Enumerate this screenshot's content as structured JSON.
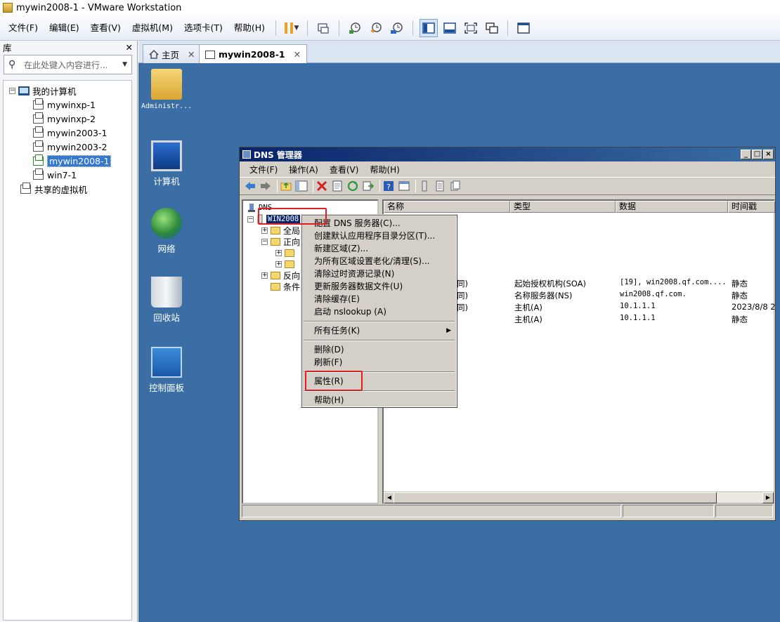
{
  "window": {
    "title": "mywin2008-1 - VMware Workstation"
  },
  "menu": [
    {
      "label": "文件(F)",
      "name": "menu-file"
    },
    {
      "label": "编辑(E)",
      "name": "menu-edit"
    },
    {
      "label": "查看(V)",
      "name": "menu-view"
    },
    {
      "label": "虚拟机(M)",
      "name": "menu-vm"
    },
    {
      "label": "选项卡(T)",
      "name": "menu-tabs"
    },
    {
      "label": "帮助(H)",
      "name": "menu-help"
    }
  ],
  "library": {
    "title": "库",
    "close": "✕",
    "search_placeholder": "在此处键入内容进行...",
    "root": "我的计算机",
    "vms": [
      "mywinxp-1",
      "mywinxp-2",
      "mywin2003-1",
      "mywin2003-2",
      "mywin2008-1",
      "win7-1"
    ],
    "selected": "mywin2008-1",
    "shared": "共享的虚拟机"
  },
  "tabs": [
    {
      "label": "主页",
      "close": "✕"
    },
    {
      "label": "mywin2008-1",
      "close": "✕"
    }
  ],
  "desktop": {
    "icons": [
      "Administr...",
      "计算机",
      "网络",
      "回收站",
      "控制面板"
    ]
  },
  "dns": {
    "title": "DNS 管理器",
    "menu": [
      "文件(F)",
      "操作(A)",
      "查看(V)",
      "帮助(H)"
    ],
    "tree": {
      "root": "DNS",
      "server": "WIN2008",
      "children": [
        "全局",
        "正向",
        "反向",
        "条件"
      ]
    },
    "columns": [
      "名称",
      "类型",
      "数据",
      "时间戳"
    ],
    "records": [
      {
        "name": "同)",
        "type": "起始授权机构(SOA)",
        "data": "[19], win2008.qf.com....",
        "stamp": "静态"
      },
      {
        "name": "同)",
        "type": "名称服务器(NS)",
        "data": "win2008.qf.com.",
        "stamp": "静态"
      },
      {
        "name": "同)",
        "type": "主机(A)",
        "data": "10.1.1.1",
        "stamp": "2023/8/8 2"
      },
      {
        "name": "",
        "type": "主机(A)",
        "data": "10.1.1.1",
        "stamp": "静态"
      }
    ]
  },
  "context_menu": {
    "items": [
      "配置 DNS 服务器(C)...",
      "创建默认应用程序目录分区(T)...",
      "新建区域(Z)...",
      "为所有区域设置老化/清理(S)...",
      "清除过时资源记录(N)",
      "更新服务器数据文件(U)",
      "清除缓存(E)",
      "启动 nslookup (A)",
      "所有任务(K)",
      "删除(D)",
      "刷新(F)",
      "属性(R)",
      "帮助(H)"
    ]
  },
  "colors": {
    "desktop_bg": "#3b6ea5",
    "title_bar": "#0a246a",
    "highlight_box": "#e02020",
    "selection": "#3478d0"
  }
}
